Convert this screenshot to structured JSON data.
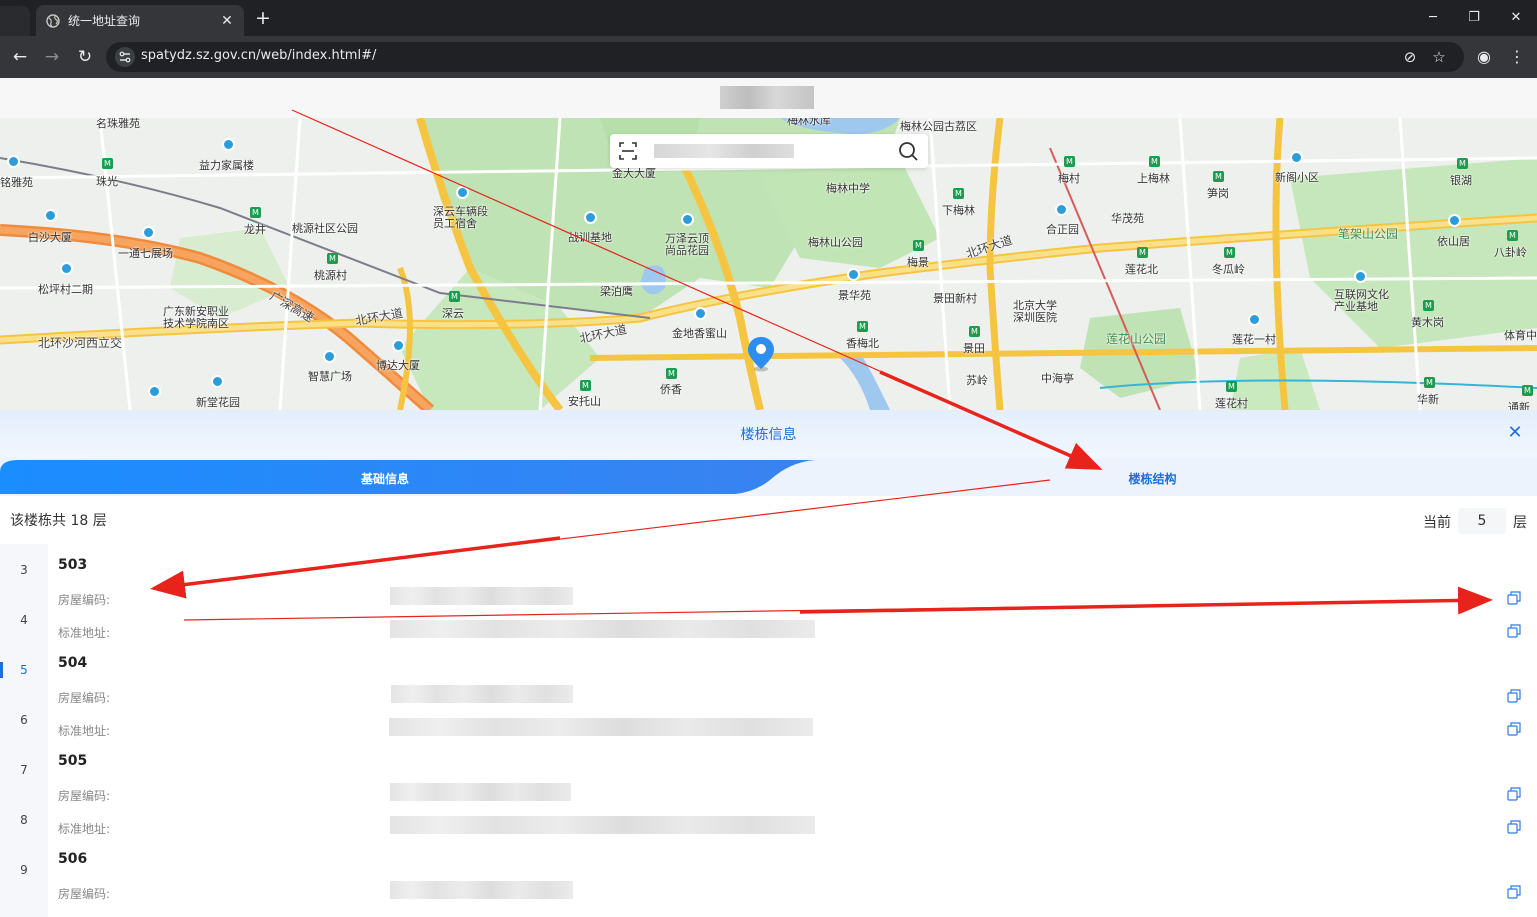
{
  "browser": {
    "tab_title": "统一地址查询",
    "url": "spatydz.sz.gov.cn/web/index.html#/",
    "new_tab_label": "+",
    "window_controls": {
      "minimize": "─",
      "maximize": "❐",
      "close": "✕"
    },
    "tab_close": "✕"
  },
  "map": {
    "labels": [
      "名珠雅苑",
      "益力家属楼",
      "珠光",
      "龙井",
      "桃源社区公园",
      "深云车辆段员工宿舍",
      "铭雅苑",
      "白沙大厦",
      "一通七展场",
      "松坪村二期",
      "桃源村",
      "广东新安职业技术学院南区",
      "北环沙河西立交",
      "广深高速",
      "北环大道",
      "深云",
      "智慧广场",
      "博达大厦",
      "新堂花园",
      "北环大道",
      "安托山",
      "侨香",
      "金地香蜜山",
      "万泽云顶尚品花园",
      "梅林中学",
      "梅林山公园",
      "景华苑",
      "香梅北",
      "梅景",
      "北环大道",
      "下梅林",
      "梅村",
      "合正园",
      "上梅林",
      "华茂苑",
      "莲花北",
      "冬瓜岭",
      "北京大学深圳医院",
      "景田",
      "中海亭",
      "莲花山公园",
      "莲花一村",
      "莲花村",
      "新阁小区",
      "笋岗",
      "银湖",
      "笔架山公园",
      "依山居",
      "八卦岭",
      "互联网文化产业基地",
      "黄木岗",
      "体育中",
      "华新",
      "通新",
      "梅林公园古荔区",
      "金大大厦",
      "战训基地",
      "梁泊鹰",
      "景田新村",
      "苏岭",
      "梅林水库"
    ]
  },
  "search": {
    "placeholder": ""
  },
  "panel": {
    "title": "楼栋信息",
    "close": "✕",
    "tabs": {
      "basic": "基础信息",
      "structure": "楼栋结构"
    },
    "floor_summary": "该楼栋共 18 层",
    "current_label": "当前",
    "current_floor": "5",
    "floor_unit": "层",
    "floors": [
      "3",
      "4",
      "5",
      "6",
      "7",
      "8",
      "9"
    ],
    "active_floor": "5",
    "rooms": [
      {
        "name": "503",
        "code_label": "房屋编码:",
        "addr_label": "标准地址:"
      },
      {
        "name": "504",
        "code_label": "房屋编码:",
        "addr_label": "标准地址:"
      },
      {
        "name": "505",
        "code_label": "房屋编码:",
        "addr_label": "标准地址:"
      },
      {
        "name": "506",
        "code_label": "房屋编码:"
      }
    ]
  },
  "colors": {
    "accent": "#1e6fd9",
    "annotation_arrow": "#e8231b",
    "chrome_dark": "#202124"
  }
}
